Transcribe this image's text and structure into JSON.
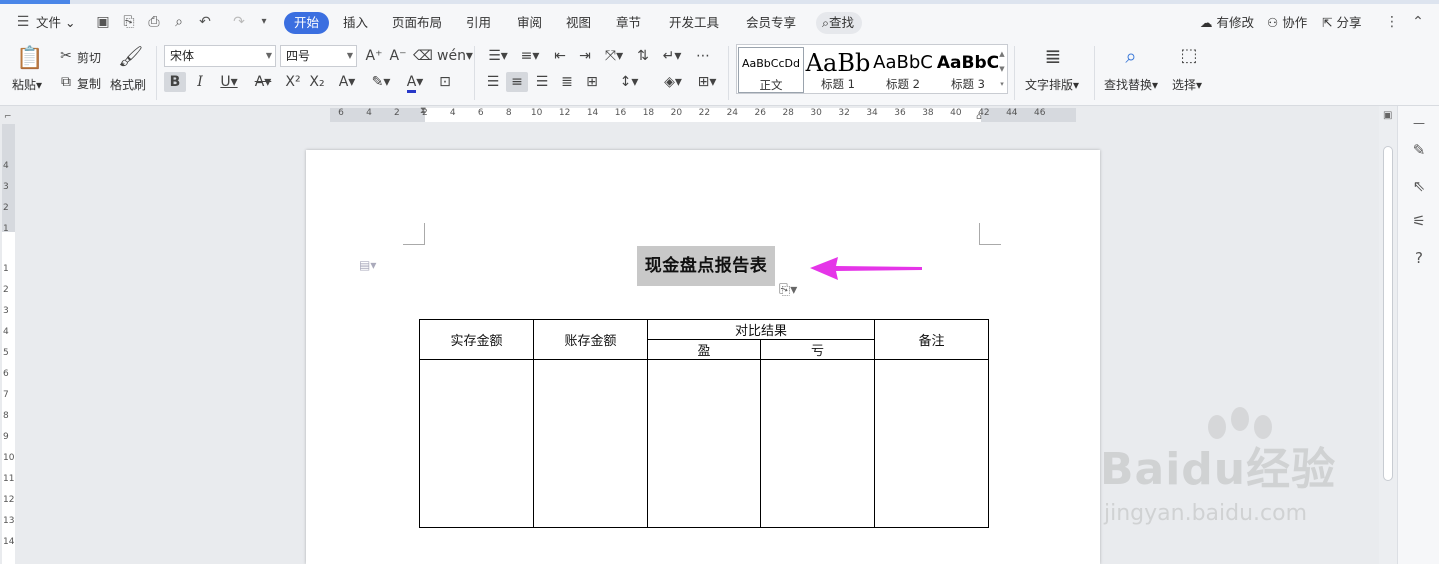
{
  "menubar": {
    "file": "文件",
    "tabs": [
      "开始",
      "插入",
      "页面布局",
      "引用",
      "审阅",
      "视图",
      "章节",
      "开发工具",
      "会员专享"
    ],
    "search": "查找",
    "right": {
      "modified": "有修改",
      "collab": "协作",
      "share": "分享"
    }
  },
  "ribbon": {
    "cut": "剪切",
    "paste": "粘贴",
    "copy": "复制",
    "format_painter": "格式刷",
    "font_name": "宋体",
    "font_size": "四号",
    "styles": [
      {
        "preview": "AaBbCcDd",
        "name": "正文"
      },
      {
        "preview": "AaBb",
        "name": "标题 1"
      },
      {
        "preview": "AaBbC",
        "name": "标题 2"
      },
      {
        "preview": "AaBbC",
        "name": "标题 3"
      }
    ],
    "text_layout": "文字排版",
    "find_replace": "查找替换",
    "select": "选择"
  },
  "ruler": {
    "h_ticks": [
      "6",
      "4",
      "2",
      "2",
      "4",
      "6",
      "8",
      "10",
      "12",
      "14",
      "16",
      "18",
      "20",
      "22",
      "24",
      "26",
      "28",
      "30",
      "32",
      "34",
      "36",
      "38",
      "40",
      "42",
      "44",
      "46"
    ],
    "v_ticks": [
      "4",
      "3",
      "2",
      "1",
      "1",
      "2",
      "3",
      "4",
      "5",
      "6",
      "7",
      "8",
      "9",
      "10",
      "11",
      "12",
      "13",
      "14"
    ]
  },
  "document": {
    "title": "现金盘点报告表",
    "table": {
      "col_actual": "实存金额",
      "col_book": "账存金额",
      "col_compare": "对比结果",
      "col_surplus": "盈",
      "col_deficit": "亏",
      "col_note": "备注"
    }
  },
  "watermark": {
    "logo": "Baidu经验",
    "url": "jingyan.baidu.com"
  },
  "colors": {
    "accent": "#3b6fe0",
    "arrow": "#e535e8"
  }
}
